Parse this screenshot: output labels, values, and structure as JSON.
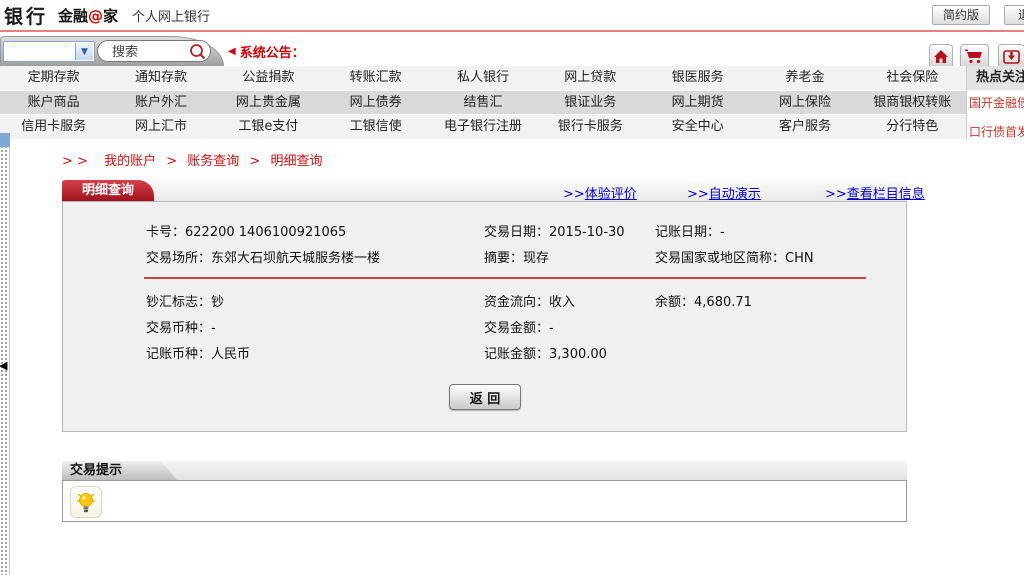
{
  "header": {
    "logo_bank": "银行",
    "brand_left": "金融",
    "brand_at": "@",
    "brand_right": "家",
    "subtitle": "个人网上银行",
    "simple_version_label": "简约版",
    "clipped_button_label": "退"
  },
  "toolbar": {
    "search_placeholder": "搜索",
    "announcement": "系统公告："
  },
  "icons": {
    "speaker_glyph": "◀",
    "collapse_arrow_glyph": "◀",
    "select_chevron_glyph": "▼",
    "quick_buttons": [
      "home-icon",
      "cart-icon",
      "mail-inbox-icon"
    ],
    "search": "magnifier-icon",
    "tips": "lightbulb-icon"
  },
  "menu": {
    "rows": [
      {
        "items": [
          "定期存款",
          "通知存款",
          "公益捐款",
          "转账汇款",
          "私人银行",
          "网上贷款",
          "银医服务",
          "养老金",
          "社会保险"
        ]
      },
      {
        "items": [
          "账户商品",
          "账户外汇",
          "网上贵金属",
          "网上债券",
          "结售汇",
          "银证业务",
          "网上期货",
          "网上保险",
          "银商银权转账"
        ]
      },
      {
        "items": [
          "信用卡服务",
          "网上汇市",
          "工银e支付",
          "工银信使",
          "电子银行注册",
          "银行卡服务",
          "安全中心",
          "客户服务",
          "分行特色"
        ]
      }
    ]
  },
  "hot_panel": {
    "title": "热点关注",
    "links": [
      "国开金融债",
      "口行债首发"
    ]
  },
  "breadcrumb": {
    "prefix": "> >",
    "separator": ">",
    "items": [
      "我的账户",
      "账务查询",
      "明细查询"
    ]
  },
  "detail": {
    "tab_title": "明细查询",
    "links": [
      {
        "arrows": ">>",
        "label": "体验评价"
      },
      {
        "arrows": ">>",
        "label": "自动演示"
      },
      {
        "arrows": ">>",
        "label": "查看栏目信息"
      }
    ],
    "rows": [
      {
        "cells": [
          {
            "label": "卡号：",
            "value": "622200 1406100921065"
          },
          {
            "label": "交易日期：",
            "value": "2015-10-30"
          },
          {
            "label": "记账日期：",
            "value": "-"
          }
        ]
      },
      {
        "cells": [
          {
            "label": "交易场所：",
            "value": "东郊大石坝航天城服务楼一楼"
          },
          {
            "label": "摘要：",
            "value": "现存"
          },
          {
            "label": "交易国家或地区简称：",
            "value": "CHN"
          }
        ]
      },
      {
        "cells": [
          {
            "label": "钞汇标志：",
            "value": "钞"
          },
          {
            "label": "资金流向：",
            "value": "收入"
          },
          {
            "label": "余额：",
            "value": "4,680.71"
          }
        ]
      },
      {
        "cells": [
          {
            "label": "交易币种：",
            "value": "-"
          },
          {
            "label": "交易金额：",
            "value": "-"
          }
        ]
      },
      {
        "cells": [
          {
            "label": "记账币种：",
            "value": "人民币"
          },
          {
            "label": "记账金额：",
            "value": "3,300.00"
          }
        ]
      }
    ],
    "back_button_label": "返 回"
  },
  "tips": {
    "title": "交易提示"
  },
  "accent_colors": {
    "brand_red": "#a91420",
    "link_blue": "#0000cc",
    "breadcrumb_red": "#cc1111",
    "hot_link_red": "#c0392b"
  }
}
